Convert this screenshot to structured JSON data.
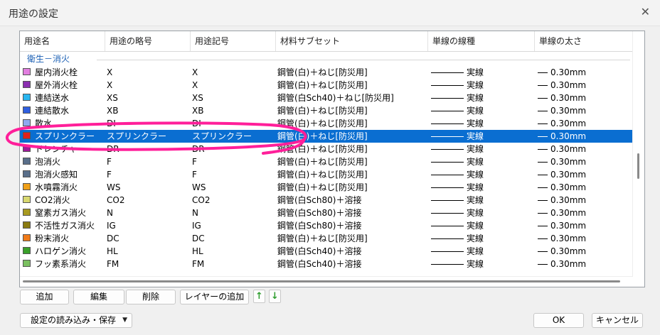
{
  "window": {
    "title": "用途の設定"
  },
  "columns": [
    "用途名",
    "用途の略号",
    "用途記号",
    "材料サブセット",
    "単線の線種",
    "単線の太さ"
  ],
  "group_label": "衛生－消火",
  "rows": [
    {
      "name": "屋内消火栓",
      "abbr": "X",
      "symbol": "X",
      "material": "鋼管(白)＋ねじ[防災用]",
      "linetype": "実線",
      "width": "0.30mm",
      "color": "#e27ee0",
      "selected": false
    },
    {
      "name": "屋外消火栓",
      "abbr": "X",
      "symbol": "X",
      "material": "鋼管(白)＋ねじ[防災用]",
      "linetype": "実線",
      "width": "0.30mm",
      "color": "#8b2fb0",
      "selected": false
    },
    {
      "name": "連結送水",
      "abbr": "XS",
      "symbol": "XS",
      "material": "鋼管(白Sch40)＋ねじ[防災用]",
      "linetype": "実線",
      "width": "0.30mm",
      "color": "#29b6f0",
      "selected": false
    },
    {
      "name": "連結散水",
      "abbr": "XB",
      "symbol": "XB",
      "material": "鋼管(白)＋ねじ[防災用]",
      "linetype": "実線",
      "width": "0.30mm",
      "color": "#2f5fe0",
      "selected": false
    },
    {
      "name": "散水",
      "abbr": "DI",
      "symbol": "DI",
      "material": "鋼管(白)＋ねじ[防災用]",
      "linetype": "実線",
      "width": "0.30mm",
      "color": "#8fa8f0",
      "selected": false
    },
    {
      "name": "スプリンクラー",
      "abbr": "スプリンクラー",
      "symbol": "スプリンクラー",
      "material": "鋼管(白)＋ねじ[防災用]",
      "linetype": "実線",
      "width": "0.30mm",
      "color": "#e0201a",
      "selected": true
    },
    {
      "name": "ドレンチャ",
      "abbr": "DR",
      "symbol": "DR",
      "material": "鋼管(白)＋ねじ[防災用]",
      "linetype": "実線",
      "width": "0.30mm",
      "color": "#a01a9a",
      "selected": false
    },
    {
      "name": "泡消火",
      "abbr": "F",
      "symbol": "F",
      "material": "鋼管(白)＋ねじ[防災用]",
      "linetype": "実線",
      "width": "0.30mm",
      "color": "#5a6f8a",
      "selected": false
    },
    {
      "name": "泡消火感知",
      "abbr": "F",
      "symbol": "F",
      "material": "鋼管(白)＋ねじ[防災用]",
      "linetype": "実線",
      "width": "0.30mm",
      "color": "#5a6f8a",
      "selected": false
    },
    {
      "name": "水噴霧消火",
      "abbr": "WS",
      "symbol": "WS",
      "material": "鋼管(白)＋ねじ[防災用]",
      "linetype": "実線",
      "width": "0.30mm",
      "color": "#f0a018",
      "selected": false
    },
    {
      "name": "CO2消火",
      "abbr": "CO2",
      "symbol": "CO2",
      "material": "鋼管(白Sch80)＋溶接",
      "linetype": "実線",
      "width": "0.30mm",
      "color": "#d8d870",
      "selected": false
    },
    {
      "name": "窒素ガス消火",
      "abbr": "N",
      "symbol": "N",
      "material": "鋼管(白Sch80)＋溶接",
      "linetype": "実線",
      "width": "0.30mm",
      "color": "#a89a20",
      "selected": false
    },
    {
      "name": "不活性ガス消火",
      "abbr": "IG",
      "symbol": "IG",
      "material": "鋼管(白Sch80)＋溶接",
      "linetype": "実線",
      "width": "0.30mm",
      "color": "#8a7a10",
      "selected": false
    },
    {
      "name": "粉末消火",
      "abbr": "DC",
      "symbol": "DC",
      "material": "鋼管(白)＋ねじ[防災用]",
      "linetype": "実線",
      "width": "0.30mm",
      "color": "#f07a18",
      "selected": false
    },
    {
      "name": "ハロゲン消火",
      "abbr": "HL",
      "symbol": "HL",
      "material": "鋼管(白Sch40)＋溶接",
      "linetype": "実線",
      "width": "0.30mm",
      "color": "#3aa02a",
      "selected": false
    },
    {
      "name": "フッ素系消火",
      "abbr": "FM",
      "symbol": "FM",
      "material": "鋼管(白Sch40)＋溶接",
      "linetype": "実線",
      "width": "0.30mm",
      "color": "#7ac060",
      "selected": false
    }
  ],
  "buttons": {
    "add": "追加",
    "edit": "編集",
    "delete": "削除",
    "add_layer": "レイヤーの追加",
    "load_save": "設定の読み込み・保存",
    "ok": "OK",
    "cancel": "キャンセル"
  },
  "icons": {
    "close": "close-icon",
    "up": "arrow-up-icon",
    "down": "arrow-down-icon",
    "dropdown": "chevron-down-icon"
  },
  "colors": {
    "selection": "#0a6ed1",
    "annotation": "#ff1f9a",
    "arrow_green": "#2e9d2e"
  }
}
